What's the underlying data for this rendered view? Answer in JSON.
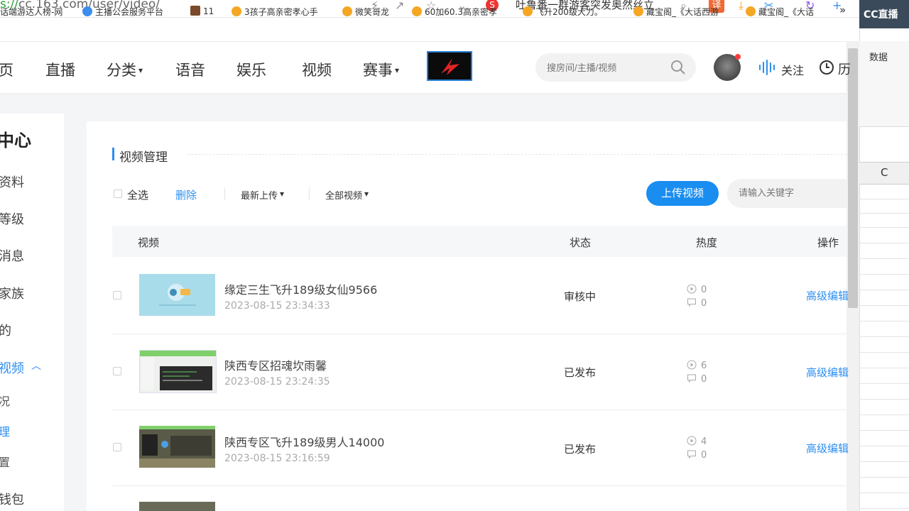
{
  "browser": {
    "url_prefix": "s://",
    "url_rest": "cc.163.com/user/video/",
    "hot_search": "吐鲁番一群游客突发奥然丝立",
    "translate_label": "译",
    "bookmarks": [
      "话端游达人榜-网",
      "主播公会服务平台",
      "11",
      "3孩子高亲密孝心手",
      "微笑哥龙",
      "60加60.3高亲密孝",
      "飞升200级大力。",
      "藏宝阁_《大话西游",
      "藏宝阁_《大话"
    ],
    "more_label": "»"
  },
  "right_panel": {
    "brand": "CC直播",
    "data_tab": "数据",
    "column": "C"
  },
  "nav": {
    "items": [
      "页",
      "直播",
      "分类",
      "语音",
      "娱乐",
      "视频",
      "赛事"
    ],
    "search_placeholder": "搜房间/主播/视频",
    "follow": "关注",
    "history": "历"
  },
  "sidebar": {
    "title": "中心",
    "items": [
      "资料",
      "等级",
      "消息",
      "家族",
      "的",
      "视频"
    ],
    "sub_items": [
      "况",
      "理",
      "置"
    ],
    "bottom": "钱包"
  },
  "main": {
    "section_title": "视频管理",
    "select_all": "全选",
    "delete": "删除",
    "sort_dropdown": "最新上传",
    "filter_dropdown": "全部视频",
    "upload_button": "上传视频",
    "keyword_placeholder": "请输入关键字",
    "columns": [
      "视频",
      "状态",
      "热度",
      "操作"
    ],
    "rows": [
      {
        "title": "缘定三生飞升189级女仙9566",
        "date": "2023-08-15 23:34:33",
        "status": "审核中",
        "plays": "0",
        "comments": "0",
        "action": "高级编辑"
      },
      {
        "title": "陕西专区招魂坎雨馨",
        "date": "2023-08-15 23:24:35",
        "status": "已发布",
        "plays": "6",
        "comments": "0",
        "action": "高级编辑"
      },
      {
        "title": "陕西专区飞升189级男人14000",
        "date": "2023-08-15 23:16:59",
        "status": "已发布",
        "plays": "4",
        "comments": "0",
        "action": "高级编辑"
      }
    ]
  },
  "colors": {
    "accent": "#2e8ff0",
    "upload_button": "#1a8df0",
    "notice_dot": "#ff3b3b"
  }
}
